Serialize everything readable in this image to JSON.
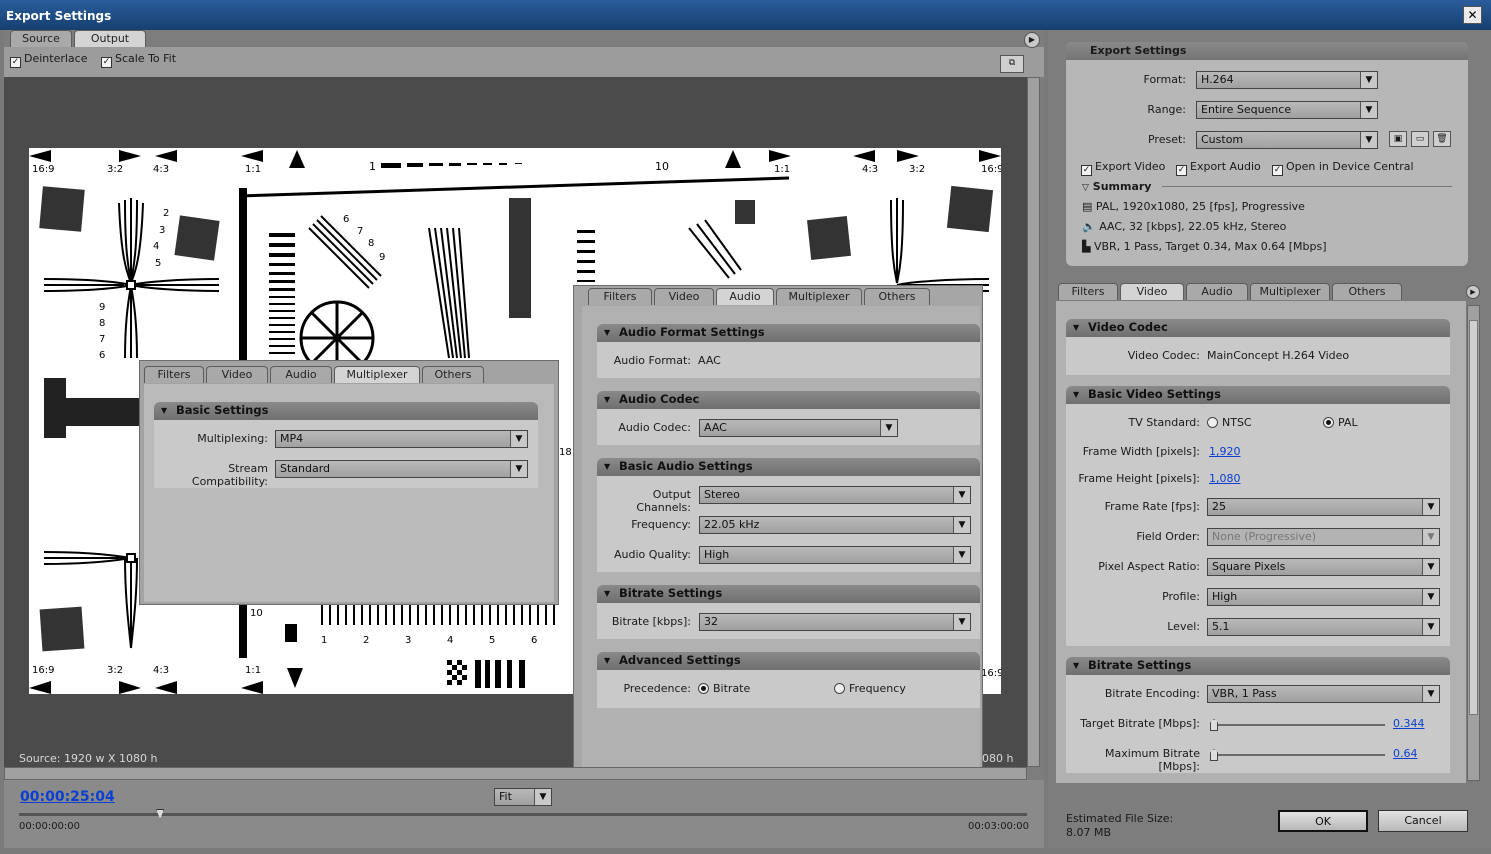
{
  "window": {
    "title": "Export Settings",
    "close": "✕"
  },
  "source_tabs": [
    "Source",
    "Output"
  ],
  "checks": {
    "deinterlace": "Deinterlace",
    "scale_to_fit": "Scale To Fit"
  },
  "preview": {
    "source_label": "Source: 1920 w X 1080 h",
    "source_right": "080 h",
    "timecode": "00:00:25:04",
    "fit": "Fit",
    "start": "00:00:00:00",
    "end": "00:03:00:00",
    "playhead_fraction": 0.14
  },
  "pattern": {
    "ratios_left": [
      "16:9",
      "3:2",
      "4:3",
      "1:1"
    ],
    "ratios_right": [
      "1:1",
      "4:3",
      "3:2",
      "16:9"
    ],
    "scale_start": "1",
    "scale_end": "10",
    "left_nums": [
      "2",
      "3",
      "4",
      "5"
    ],
    "left_nums2": [
      "9",
      "8",
      "7",
      "6"
    ],
    "wedge_nums": [
      "6",
      "7",
      "8",
      "9"
    ],
    "bottom_nums": [
      "1",
      "2",
      "3",
      "4",
      "5",
      "6"
    ],
    "small_labels": [
      "10",
      "18"
    ]
  },
  "mux_panel": {
    "tabs": [
      "Filters",
      "Video",
      "Audio",
      "Multiplexer",
      "Others"
    ],
    "section": "Basic Settings",
    "multiplexing_label": "Multiplexing:",
    "multiplexing": "MP4",
    "compat_label": "Stream Compatibility:",
    "compat": "Standard"
  },
  "audio_panel": {
    "tabs": [
      "Filters",
      "Video",
      "Audio",
      "Multiplexer",
      "Others"
    ],
    "format_section": "Audio Format Settings",
    "format_label": "Audio Format:",
    "format": "AAC",
    "codec_section": "Audio Codec",
    "codec_label": "Audio Codec:",
    "codec": "AAC",
    "basic_section": "Basic Audio Settings",
    "channels_label": "Output Channels:",
    "channels": "Stereo",
    "freq_label": "Frequency:",
    "freq": "22.05 kHz",
    "quality_label": "Audio Quality:",
    "quality": "High",
    "bitrate_section": "Bitrate Settings",
    "bitrate_label": "Bitrate [kbps]:",
    "bitrate": "32",
    "adv_section": "Advanced Settings",
    "precedence_label": "Precedence:",
    "prec_bitrate": "Bitrate",
    "prec_freq": "Frequency"
  },
  "export": {
    "header": "Export Settings",
    "format_label": "Format:",
    "format": "H.264",
    "range_label": "Range:",
    "range": "Entire Sequence",
    "preset_label": "Preset:",
    "preset": "Custom",
    "export_video": "Export Video",
    "export_audio": "Export Audio",
    "device_central": "Open in Device Central",
    "summary": "Summary",
    "summary_video": "PAL, 1920x1080, 25 [fps], Progressive",
    "summary_audio": "AAC, 32 [kbps], 22.05 kHz, Stereo",
    "summary_bitrate": "VBR, 1 Pass, Target 0.34, Max 0.64 [Mbps]"
  },
  "right_tabs": [
    "Filters",
    "Video",
    "Audio",
    "Multiplexer",
    "Others"
  ],
  "video": {
    "codec_section": "Video Codec",
    "codec_label": "Video Codec:",
    "codec": "MainConcept H.264 Video",
    "basic_section": "Basic Video Settings",
    "tv_label": "TV Standard:",
    "ntsc": "NTSC",
    "pal": "PAL",
    "width_label": "Frame Width [pixels]:",
    "width": "1,920",
    "height_label": "Frame Height [pixels]:",
    "height": "1,080",
    "rate_label": "Frame Rate [fps]:",
    "rate": "25",
    "field_label": "Field Order:",
    "field": "None (Progressive)",
    "par_label": "Pixel Aspect Ratio:",
    "par": "Square Pixels",
    "profile_label": "Profile:",
    "profile": "High",
    "level_label": "Level:",
    "level": "5.1",
    "bitrate_section": "Bitrate Settings",
    "enc_label": "Bitrate Encoding:",
    "enc": "VBR, 1 Pass",
    "target_label": "Target Bitrate [Mbps]:",
    "target": "0.344",
    "max_label": "Maximum Bitrate [Mbps]:",
    "max": "0.64"
  },
  "footer": {
    "est_label": "Estimated File Size:",
    "est_value": "8.07 MB",
    "ok": "OK",
    "cancel": "Cancel"
  },
  "colors": {
    "title_bar": "#1f4e87",
    "link": "#0a3fd0",
    "panel": "#a8a8a8"
  }
}
